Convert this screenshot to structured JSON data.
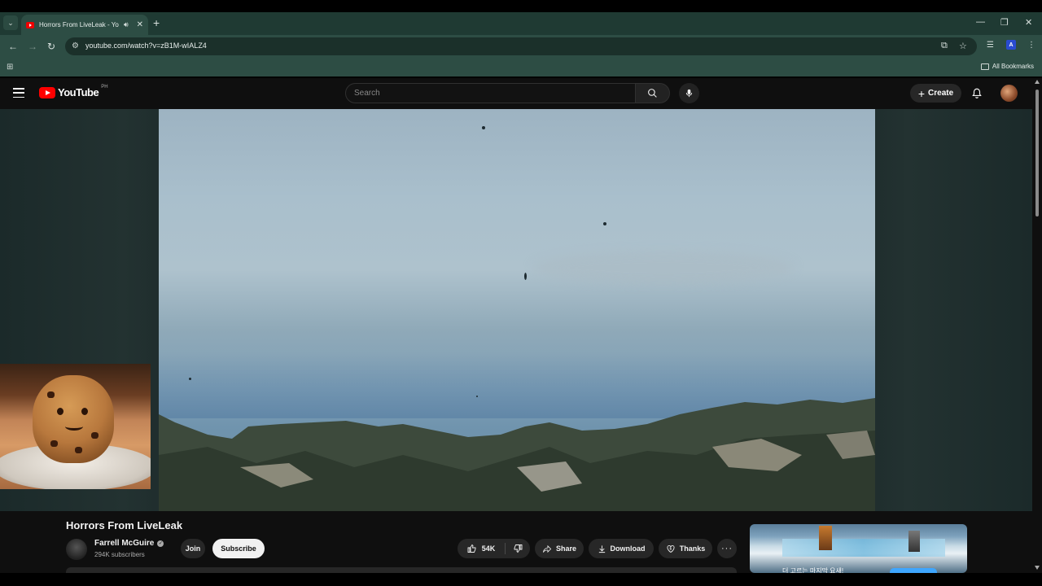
{
  "browser": {
    "tab": {
      "title": "Horrors From LiveLeak - YouTube"
    },
    "url": "youtube.com/watch?v=zB1M-wIALZ4",
    "bookmarks": {
      "all_label": "All Bookmarks"
    }
  },
  "youtube": {
    "logo_text": "YouTube",
    "country_code": "PH",
    "search": {
      "placeholder": "Search"
    },
    "create_label": "Create"
  },
  "video": {
    "title": "Horrors From LiveLeak",
    "channel": {
      "name": "Farrell McGuire",
      "subscribers": "294K subscribers"
    },
    "join_label": "Join",
    "subscribe_label": "Subscribe",
    "actions": {
      "likes": "54K",
      "share_label": "Share",
      "download_label": "Download",
      "thanks_label": "Thanks"
    }
  },
  "sidebar_ad": {
    "caption": "더 고르는 마지막 요새!"
  },
  "colors": {
    "browser_chrome": "#2d4d44",
    "youtube_red": "#ff0000",
    "background": "#0f0f0f",
    "pill": "#272727"
  },
  "icons": [
    "tab-list-icon",
    "audio-icon",
    "close-icon",
    "plus-icon",
    "back-icon",
    "forward-icon",
    "reload-icon",
    "site-info-icon",
    "install-icon",
    "star-icon",
    "reading-list-icon",
    "extension-icon",
    "kebab-icon",
    "apps-icon",
    "folder-icon",
    "hamburger-icon",
    "search-icon",
    "mic-icon",
    "bell-icon",
    "verified-icon",
    "like-icon",
    "dislike-icon",
    "share-icon",
    "download-icon",
    "thanks-icon",
    "more-icon"
  ]
}
